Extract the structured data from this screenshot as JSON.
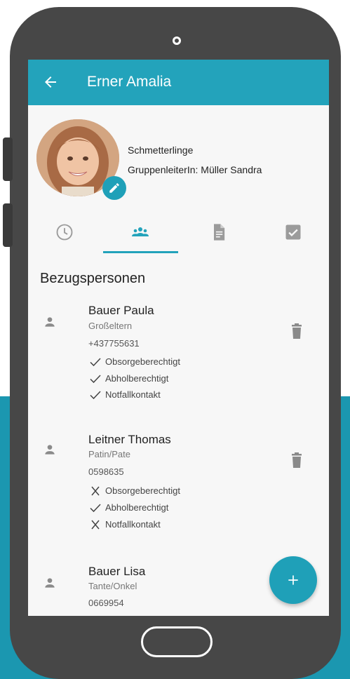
{
  "colors": {
    "accent": "#23a3bb",
    "phone_body": "#474747",
    "background_band": "#1b97b0"
  },
  "appbar": {
    "title": "Erner Amalia",
    "back_icon": "arrow-left-icon"
  },
  "profile": {
    "group": "Schmetterlinge",
    "leader": "GruppenleiterIn: Müller Sandra",
    "edit_icon": "pencil-icon"
  },
  "tabs": [
    {
      "icon": "clock-icon",
      "selected": false
    },
    {
      "icon": "people-icon",
      "selected": true
    },
    {
      "icon": "document-icon",
      "selected": false
    },
    {
      "icon": "checkbox-icon",
      "selected": false
    }
  ],
  "section_title": "Bezugspersonen",
  "contacts": [
    {
      "name": "Bauer Paula",
      "relation": "Großeltern",
      "phone": "+437755631",
      "permissions": [
        {
          "label": "Obsorgeberechtigt",
          "granted": true
        },
        {
          "label": "Abholberechtigt",
          "granted": true
        },
        {
          "label": "Notfallkontakt",
          "granted": true
        }
      ]
    },
    {
      "name": "Leitner  Thomas",
      "relation": "Patin/Pate",
      "phone": "0598635",
      "permissions": [
        {
          "label": "Obsorgeberechtigt",
          "granted": false
        },
        {
          "label": "Abholberechtigt",
          "granted": true
        },
        {
          "label": "Notfallkontakt",
          "granted": false
        }
      ]
    },
    {
      "name": "Bauer  Lisa",
      "relation": "Tante/Onkel",
      "phone": "0669954"
    }
  ],
  "fab_icon": "plus-icon"
}
